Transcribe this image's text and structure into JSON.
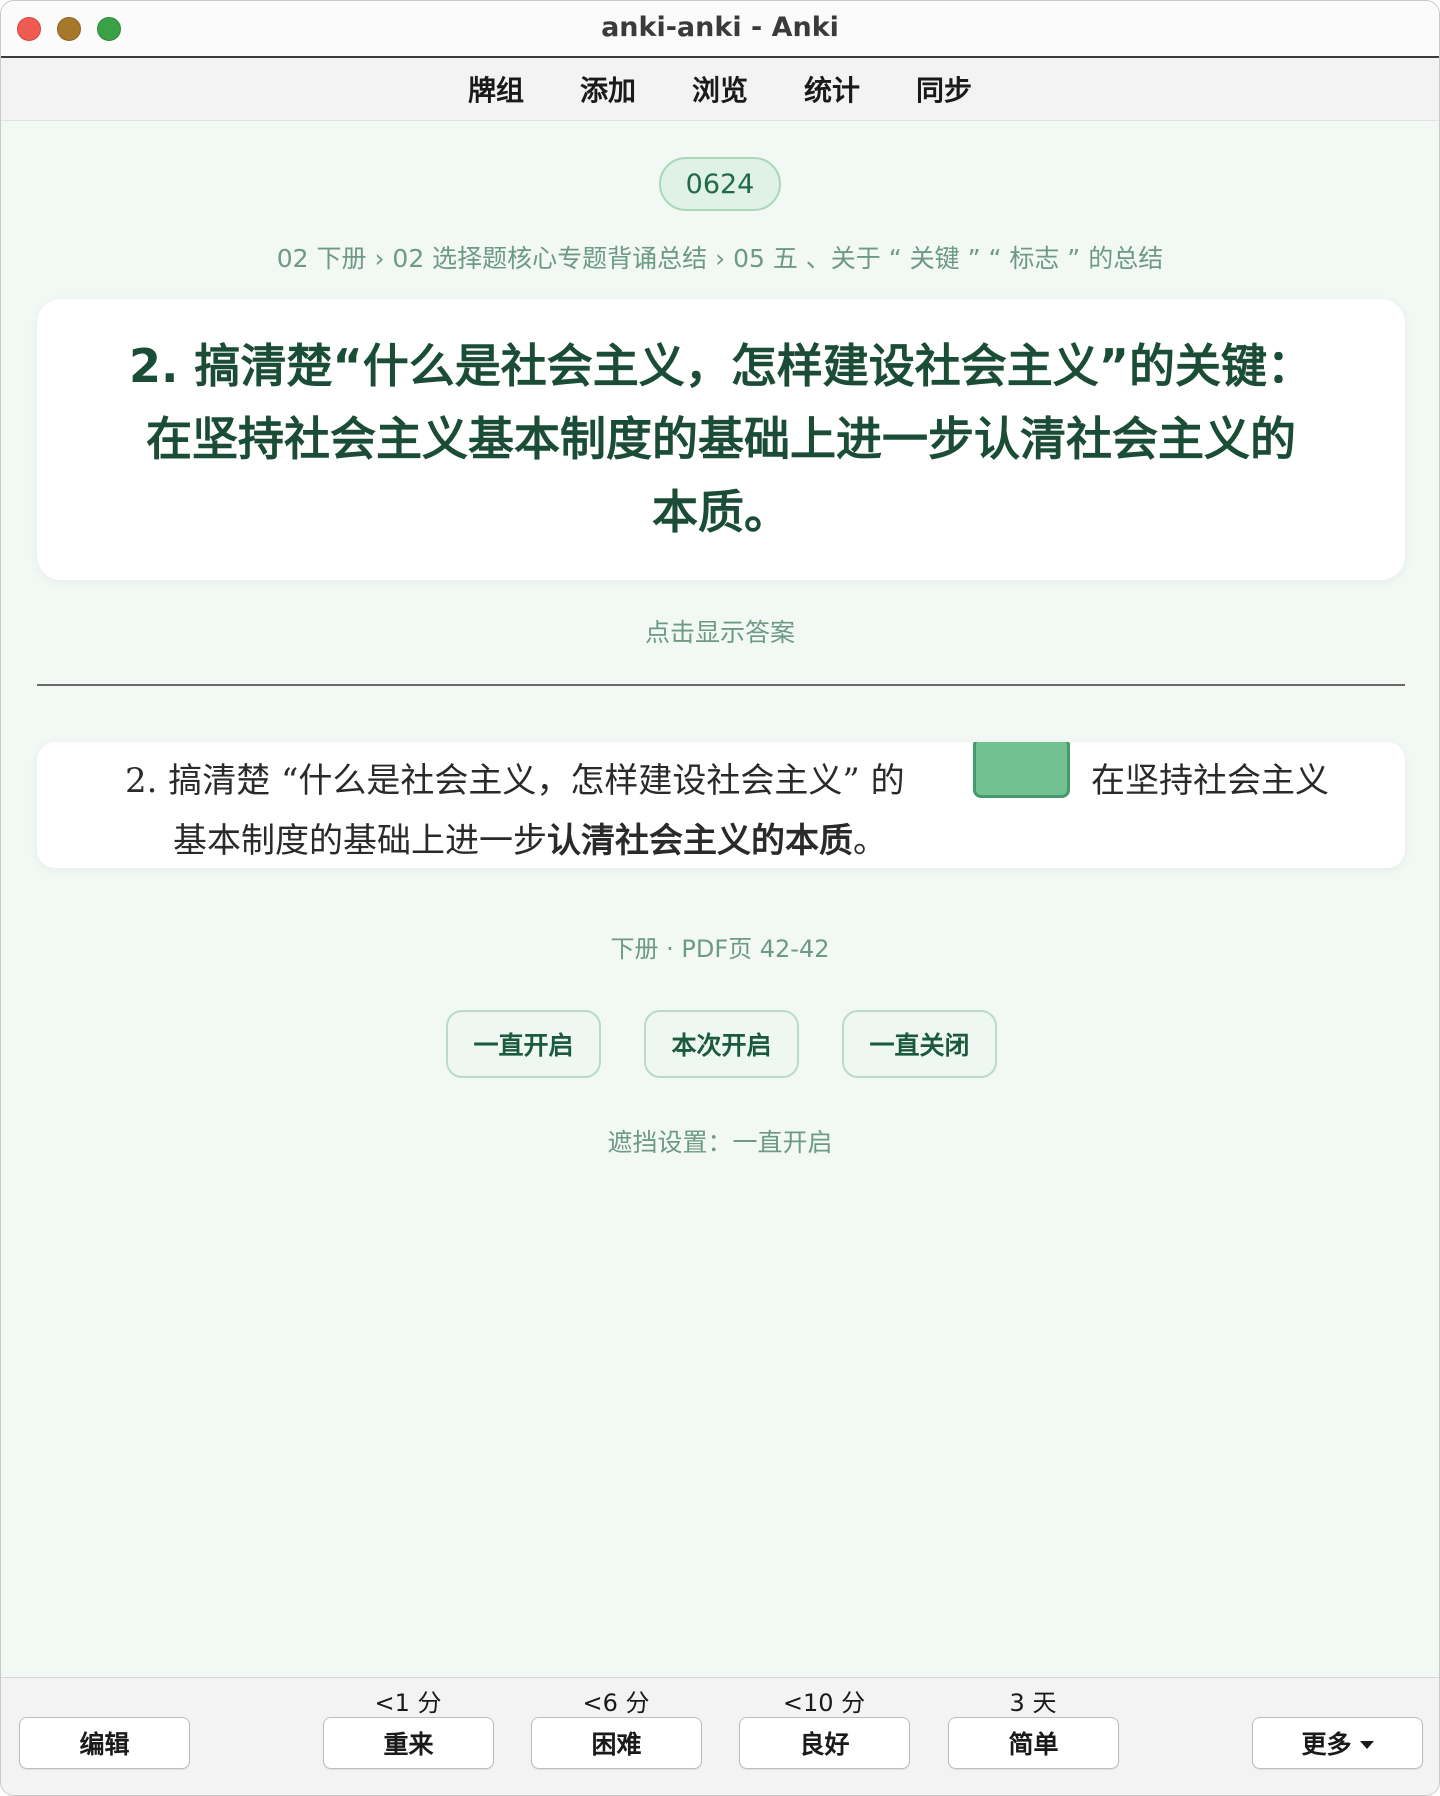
{
  "window": {
    "title": "anki-anki - Anki"
  },
  "menu": [
    "牌组",
    "添加",
    "浏览",
    "统计",
    "同步"
  ],
  "card": {
    "deck_label": "0624",
    "breadcrumb": "02 下册 › 02 选择题核心专题背诵总结 › 05 五 、关于 “ 关键 ” “ 标志 ” 的总结",
    "question_line1": "2. 搞清楚“什么是社会主义，怎样建设社会主义”的关键：",
    "question_line2": "在坚持社会主义基本制度的基础上进一步认清社会主义的",
    "question_line3": "本质。",
    "show_answer": "点击显示答案",
    "pdf_line1_left": "2.  搞清楚 “什么是社会主义，怎样建设社会主义” 的",
    "pdf_line1_right": "在坚持社会主义",
    "pdf_line2_normal": "基本制度的基础上进一步",
    "pdf_line2_bold": "认清社会主义的本质",
    "pdf_line2_end": "。",
    "source": "下册 · PDF页 42-42",
    "mask_buttons": [
      "一直开启",
      "本次开启",
      "一直关闭"
    ],
    "mask_setting": "遮挡设置：一直开启"
  },
  "bottom": {
    "edit": "编辑",
    "more": "更多",
    "answers": [
      {
        "label": "重来",
        "interval": "<1 分"
      },
      {
        "label": "困难",
        "interval": "<6 分"
      },
      {
        "label": "良好",
        "interval": "<10 分"
      },
      {
        "label": "简单",
        "interval": "3 天"
      }
    ]
  },
  "colors": {
    "accent_green": "#1b4d36",
    "mask_green": "#6fbf8e",
    "background": "#f2f8f4"
  }
}
